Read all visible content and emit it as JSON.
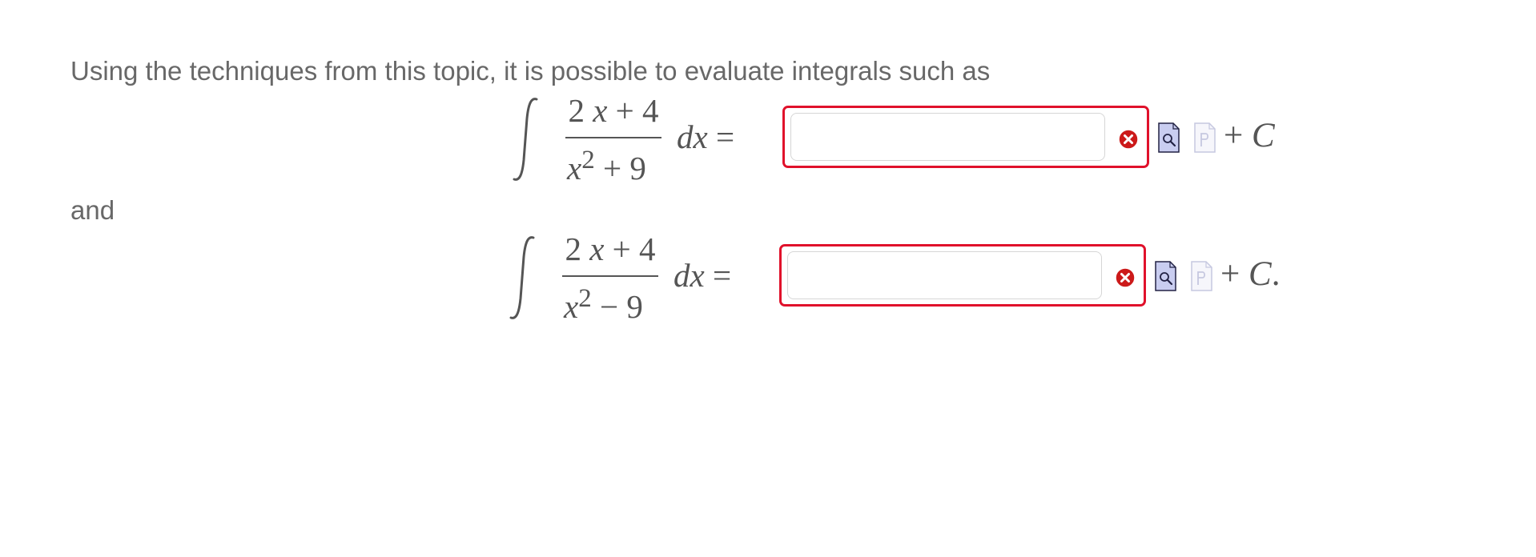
{
  "intro_text": "Using the techniques from this topic, it is possible to evaluate integrals such as",
  "connector_text": "and",
  "equations": [
    {
      "numerator_coeff": "2",
      "numerator_var": "x",
      "numerator_rest": " + 4",
      "denominator_var": "x",
      "denominator_exp": "2",
      "denominator_rest": " + 9",
      "differential": "dx",
      "equals": " =",
      "answer_value": "",
      "constant_plus": "+ ",
      "constant": "C",
      "constant_suffix": ""
    },
    {
      "numerator_coeff": "2",
      "numerator_var": "x",
      "numerator_rest": " + 4",
      "denominator_var": "x",
      "denominator_exp": "2",
      "denominator_rest": " − 9",
      "differential": "dx",
      "equals": " =",
      "answer_value": "",
      "constant_plus": "+ ",
      "constant": "C",
      "constant_suffix": "."
    }
  ],
  "colors": {
    "error_border": "#e0112b",
    "error_icon": "#cc1a1a",
    "preview_icon": "#c9cdf0",
    "text": "#686868",
    "math": "#555555"
  },
  "icons": [
    "integral-sign",
    "error-icon",
    "preview-document-icon",
    "prompt-document-icon"
  ]
}
